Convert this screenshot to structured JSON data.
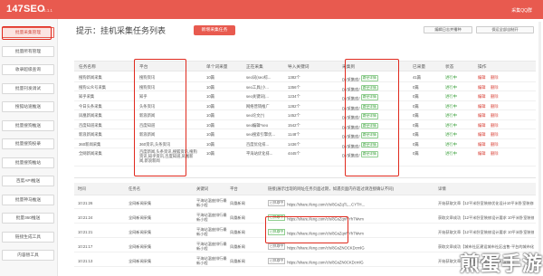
{
  "topbar": {
    "brand": "147SEO",
    "version": "v1.1.1",
    "right_text": "采集QQ群",
    "color": "#e85a4f"
  },
  "sidebar": {
    "items": [
      {
        "label": "批量采集管理",
        "active": true
      },
      {
        "label": "批量所有管理"
      },
      {
        "label": "收录超级查询"
      },
      {
        "label": "批量刊发调试"
      },
      {
        "label": "搜狐站速推送"
      },
      {
        "label": "批量搜狗推送"
      },
      {
        "label": "批量搜狗投录"
      },
      {
        "label": "批量搜狗推站"
      },
      {
        "label": "百度API推送"
      },
      {
        "label": "批量神马推送"
      },
      {
        "label": "批量360推送"
      },
      {
        "label": "链接生成工具"
      },
      {
        "label": "内容替工具"
      }
    ]
  },
  "header": {
    "title": "提示：挂机采集任务列表",
    "new_task": "新增采集任务",
    "btn_right1": "编辑日志并播种",
    "btn_right2": "保运全部自制开"
  },
  "grid": {
    "columns": [
      "任务名称",
      "平台",
      "单个词采量",
      "正在采集",
      "导入关键词",
      "采集到",
      "已采量",
      "状态",
      "操作"
    ],
    "rows": [
      {
        "name": "搜狗新闻采集",
        "platform": "搜狗资讯",
        "per": "10篇",
        "current": "seo词(seo综...",
        "kw": "1382个",
        "collect_path": "D:/采集库/",
        "collected": "41篇",
        "status": "进行中",
        "ops": [
          "编辑",
          "删除"
        ]
      },
      {
        "name": "搜狗公众号采集",
        "platform": "搜狗资讯",
        "per": "10篇",
        "current": "seo工具(小...",
        "kw": "1356个",
        "collect_path": "D:/采集库/",
        "collected": "0篇",
        "status": "进行中",
        "ops": [
          "编辑",
          "删除"
        ]
      },
      {
        "name": "知乎采集",
        "platform": "知乎",
        "per": "10篇",
        "current": "seo关键词(...",
        "kw": "1234个",
        "collect_path": "D:/采集库/",
        "collected": "0篇",
        "status": "进行中",
        "ops": [
          "编辑",
          "删除"
        ]
      },
      {
        "name": "今日头条采集",
        "platform": "头条资讯",
        "per": "10篇",
        "current": "网络营销推广",
        "kw": "1282个",
        "collect_path": "D:/采集库/",
        "collected": "0篇",
        "status": "进行中",
        "ops": [
          "编辑",
          "删除"
        ]
      },
      {
        "name": "凤凰新闻采集",
        "platform": "新浪新闻",
        "per": "10篇",
        "current": "seo论文(*)",
        "kw": "1452个",
        "collect_path": "D:/采集库/",
        "collected": "0篇",
        "status": "进行中",
        "ops": [
          "编辑",
          "删除"
        ]
      },
      {
        "name": "百度知道采集",
        "platform": "百度知道",
        "per": "10篇",
        "current": "seo编辑*seo",
        "kw": "1542个",
        "collect_path": "D:/采集库/",
        "collected": "0篇",
        "status": "进行中",
        "ops": [
          "编辑",
          "删除"
        ]
      },
      {
        "name": "新浪新闻采集",
        "platform": "新浪新闻",
        "per": "10篇",
        "current": "seo搜索引擎优...",
        "kw": "1148个",
        "collect_path": "D:/采集库/",
        "collected": "0篇",
        "status": "进行中",
        "ops": [
          "编辑",
          "删除"
        ]
      },
      {
        "name": "360新闻采集",
        "platform": "360资讯,头条资讯",
        "per": "10篇",
        "current": "百度优化排...",
        "kw": "1436个",
        "collect_path": "D:/采集库/",
        "collected": "0篇",
        "status": "进行中",
        "ops": [
          "编辑",
          "删除"
        ]
      },
      {
        "name": "全网新闻采集",
        "platform": "百度新闻,头条资讯,搜狐资讯,搜狗资讯,知乎资讯,百度知道,凤凰新闻,新浪新闻",
        "per": "10篇",
        "current": "平海站优化排...",
        "kw": "4445个",
        "collect_path": "D:/采集库/",
        "collected": "0篇",
        "status": "进行中",
        "ops": [
          "编辑",
          "删除"
        ]
      }
    ],
    "collect_tag": "路径详情"
  },
  "log": {
    "columns": [
      "时间",
      "任务名",
      "关键词",
      "平台",
      "链接(展示出现的网址任务页面过期，如遇页面内存超过请连接确认不同)",
      "详情"
    ],
    "rows": [
      {
        "time": "10:21:26",
        "task": "全网新闻采集",
        "kw": "平海站温座排行最新小程",
        "platform": "凤凰新闻",
        "tag": "已抓取中",
        "tag_style": "gray",
        "url": "https://share.ifeng.com/c/s/8GsZqTL...CYTH...",
        "detail": "开始获取文章【12平米卧室装修优化设计10平米卧室装修要点小技】"
      },
      {
        "time": "10:21:24",
        "task": "全网新闻采集",
        "kw": "平海站温座排行最新小程",
        "platform": "凤凰新闻",
        "tag": "已抓取中",
        "tag_style": "green",
        "url": "https://share.ifeng.com/c/s/8GsZqnRYhTMvm",
        "detail": "获取文章成功【12平米卧室装修设计要求 10平米卧室装修要点小技】"
      },
      {
        "time": "10:21:21",
        "task": "全网新闻采集",
        "kw": "平海站温座排行最新小程",
        "platform": "凤凰新闻",
        "tag": "已抓取中",
        "tag_style": "green",
        "url": "https://share.ifeng.com/c/s/8GsZqnRYhTMvm",
        "detail": "开始获取文章【12平米卧室装修设计要求 10平米卧室装修要点小技】"
      },
      {
        "time": "10:21:17",
        "task": "全网新闻采集",
        "kw": "平海站温座排行最新小程",
        "platform": "凤凰新闻",
        "tag": "已抓取中",
        "tag_style": "gray",
        "url": "https://share.ifeng.com/c/s/8GsZNOCKDcrnlG",
        "detail": "获取文章成功【城市社区建设城市社区出售-平台的城市化-项目工程的出让优化】"
      },
      {
        "time": "10:21:13",
        "task": "全网新闻采集",
        "kw": "平海站温座排行最新小程",
        "platform": "凤凰新闻",
        "tag": "已抓取中",
        "tag_style": "gray",
        "url": "https://share.ifeng.com/c/s/8GsZN0CKDcrnlG",
        "detail": "开始获取文章【城市社区建设城市社区出售】"
      }
    ]
  },
  "watermark": "煎蛋手游"
}
